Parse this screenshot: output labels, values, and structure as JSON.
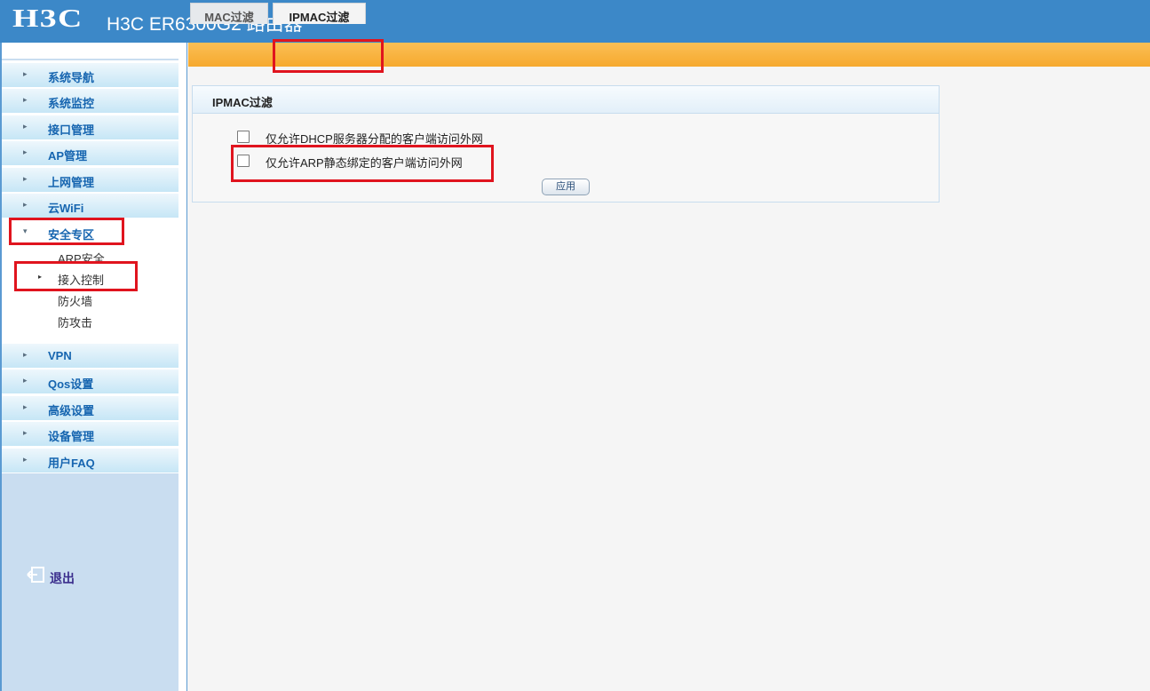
{
  "header": {
    "logo": "H3C",
    "title": "H3C ER6300G2 路由器"
  },
  "sidebar": {
    "items": [
      {
        "label": "系统导航"
      },
      {
        "label": "系统监控"
      },
      {
        "label": "接口管理"
      },
      {
        "label": "AP管理"
      },
      {
        "label": "上网管理"
      },
      {
        "label": "云WiFi"
      },
      {
        "label": "安全专区",
        "expanded": true
      },
      {
        "label": "VPN"
      },
      {
        "label": "Qos设置"
      },
      {
        "label": "高级设置"
      },
      {
        "label": "设备管理"
      },
      {
        "label": "用户FAQ"
      }
    ],
    "sub_items": [
      {
        "label": "ARP安全"
      },
      {
        "label": "接入控制",
        "selected": true
      },
      {
        "label": "防火墙"
      },
      {
        "label": "防攻击"
      }
    ],
    "logout_label": "退出"
  },
  "tabs": [
    {
      "label": "MAC过滤",
      "active": false
    },
    {
      "label": "IPMAC过滤",
      "active": true
    }
  ],
  "panel": {
    "title": "IPMAC过滤",
    "options": [
      {
        "label": "仅允许DHCP服务器分配的客户端访问外网",
        "checked": false
      },
      {
        "label": "仅允许ARP静态绑定的客户端访问外网",
        "checked": false
      }
    ],
    "apply_label": "应用"
  },
  "colors": {
    "header_bg": "#3c88c8",
    "tabbar_bg": "#f6a92e",
    "nav_label": "#1665b0",
    "highlight": "#e0141e"
  }
}
